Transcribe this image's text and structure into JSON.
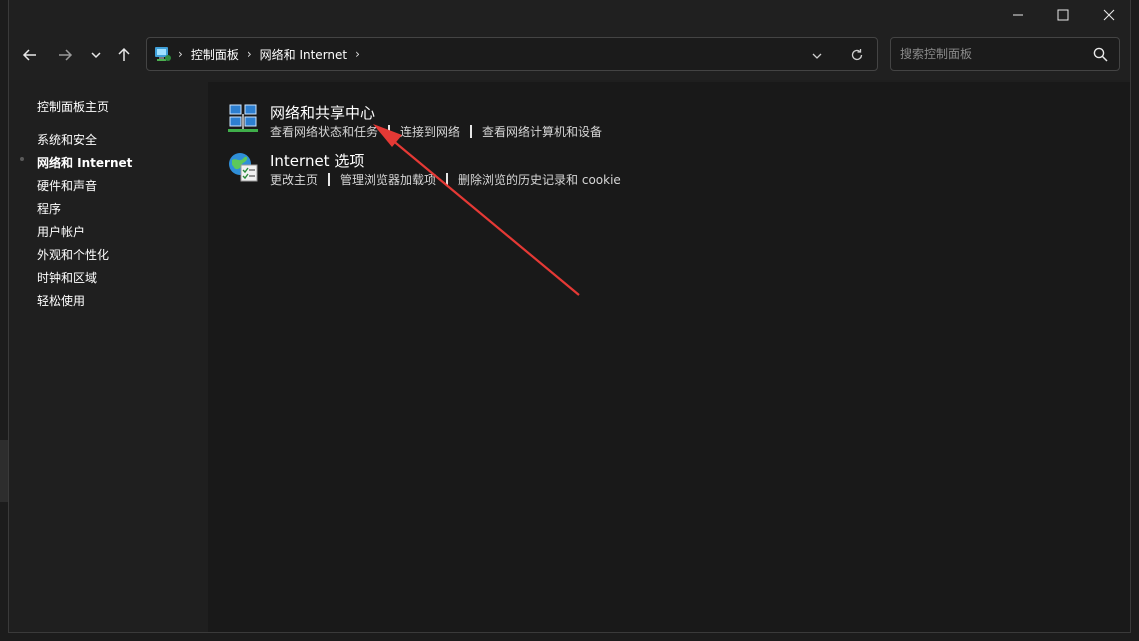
{
  "window": {
    "controls": {
      "minimize": "minimize-icon",
      "maximize": "maximize-icon",
      "close": "close-icon"
    }
  },
  "nav": {
    "breadcrumb": [
      "控制面板",
      "网络和 Internet"
    ],
    "search_placeholder": "搜索控制面板"
  },
  "sidebar": {
    "home": "控制面板主页",
    "items": [
      {
        "label": "系统和安全",
        "active": false
      },
      {
        "label": "网络和 Internet",
        "active": true
      },
      {
        "label": "硬件和声音",
        "active": false
      },
      {
        "label": "程序",
        "active": false
      },
      {
        "label": "用户帐户",
        "active": false
      },
      {
        "label": "外观和个性化",
        "active": false
      },
      {
        "label": "时钟和区域",
        "active": false
      },
      {
        "label": "轻松使用",
        "active": false
      }
    ]
  },
  "categories": [
    {
      "title": "网络和共享中心",
      "icon": "network-sharing-center-icon",
      "links": [
        "查看网络状态和任务",
        "连接到网络",
        "查看网络计算机和设备"
      ]
    },
    {
      "title": "Internet 选项",
      "icon": "internet-options-icon",
      "links": [
        "更改主页",
        "管理浏览器加载项",
        "删除浏览的历史记录和 cookie"
      ]
    }
  ],
  "annotation": {
    "color": "#e53935"
  }
}
